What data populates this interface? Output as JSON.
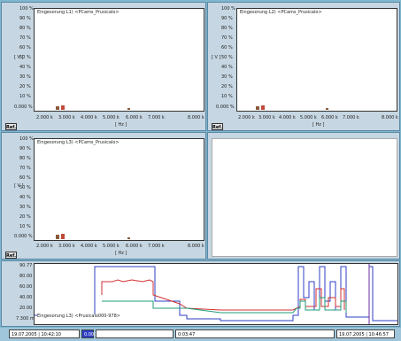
{
  "panels": [
    {
      "id": "top-left",
      "legend": "Eingesorung L1)   <PCams_Prusicalo>",
      "ref": "Ref.",
      "y_label": "[ V ]",
      "x_label": "[ Hz ]",
      "y_ticks": [
        "100 %",
        "90 %",
        "80 %",
        "70 %",
        "60 %",
        "50 %",
        "40 %",
        "30 %",
        "20 %",
        "10 %",
        "0.000 %"
      ],
      "x_ticks": [
        "2.000 k",
        "3.000 k",
        "4.000 k",
        "5.000 k",
        "6.000 k",
        "7.000 k",
        "8.000 k"
      ]
    },
    {
      "id": "top-right",
      "legend": "Eingesorung L2)   <PCams_Prusicalo>",
      "ref": "Ref.",
      "y_label": "[ V ]",
      "x_label": "[ Hz ]",
      "y_ticks": [
        "100 %",
        "90 %",
        "80 %",
        "70 %",
        "60 %",
        "50 %",
        "40 %",
        "30 %",
        "20 %",
        "10 %",
        "0.000 %"
      ],
      "x_ticks": [
        "2.000 k",
        "3.000 k",
        "4.000 k",
        "5.000 k",
        "6.000 k",
        "7.000 k",
        "8.000 k"
      ]
    },
    {
      "id": "bottom-left",
      "legend": "Eingesorung L3)   <PCams_Prusicalo>",
      "ref": "Ref.",
      "y_label": "[ V ]",
      "x_label": "[ Hz ]",
      "y_ticks": [
        "100 %",
        "90 %",
        "80 %",
        "70 %",
        "60 %",
        "50 %",
        "40 %",
        "30 %",
        "20 %",
        "10 %",
        "0.000 %"
      ],
      "x_ticks": [
        "2.000 k",
        "3.000 k",
        "4.000 k",
        "5.000 k",
        "6.000 k",
        "7.000 k",
        "8.000 k"
      ]
    }
  ],
  "trend": {
    "legend": "Eingesorung L3)   <Prusicalo000-978>",
    "y_ticks": [
      "90.77",
      "80.00",
      "60.00",
      "40.00",
      "20.00",
      "7.300 m"
    ],
    "ref": "Ref."
  },
  "status": {
    "start": "19.07.2005 | 10:42:10",
    "cursor": "0.000",
    "duration": "0:03:47",
    "end": "19.07.2005 | 10:46:57"
  },
  "colors": {
    "background": "#7fb7cf",
    "pane": "#c6d6e2",
    "trace_blue": "#2c3fc4",
    "trace_red": "#d23030",
    "trace_green": "#1f9c7a",
    "bar_red": "#c24a3a",
    "bar_brown": "#8a5a3a"
  }
}
